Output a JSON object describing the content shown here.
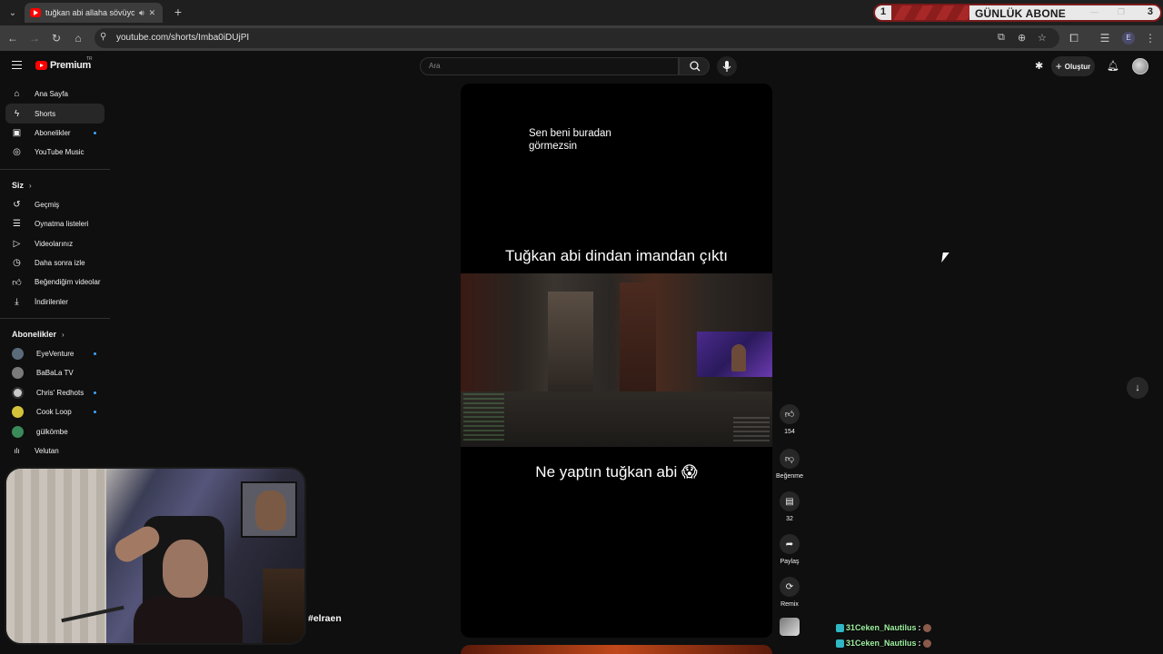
{
  "browser": {
    "tab_title": "tuğkan abi allaha sövüyor 4",
    "url": "youtube.com/shorts/Imba0iDUjPI",
    "profile_initial": "E"
  },
  "overlay_banner": {
    "left_number": "1",
    "label": "GÜNLÜK ABONE",
    "right_number": "3"
  },
  "header": {
    "logo_text": "Premium",
    "region": "TR",
    "search_placeholder": "Ara",
    "create_label": "Oluştur"
  },
  "sidebar": {
    "main": [
      {
        "label": "Ana Sayfa",
        "icon": "home-icon"
      },
      {
        "label": "Shorts",
        "icon": "shorts-icon"
      },
      {
        "label": "Abonelikler",
        "icon": "subscriptions-icon"
      },
      {
        "label": "YouTube Music",
        "icon": "music-icon"
      }
    ],
    "you_title": "Siz",
    "you": [
      {
        "label": "Geçmiş",
        "icon": "history-icon"
      },
      {
        "label": "Oynatma listeleri",
        "icon": "playlist-icon"
      },
      {
        "label": "Videolarınız",
        "icon": "your-videos-icon"
      },
      {
        "label": "Daha sonra izle",
        "icon": "watch-later-icon"
      },
      {
        "label": "Beğendiğim videolar",
        "icon": "liked-icon"
      },
      {
        "label": "İndirilenler",
        "icon": "download-icon"
      }
    ],
    "subs_title": "Abonelikler",
    "subs": [
      {
        "label": "EyeVenture",
        "color": "#5a6b7a"
      },
      {
        "label": "BaBaLa TV",
        "color": "#7a7a7a"
      },
      {
        "label": "Chris' Redhots",
        "color": "#c9c9c9"
      },
      {
        "label": "Cook Loop",
        "color": "#d4c23a"
      },
      {
        "label": "gülkömbe",
        "color": "#3a8a5a"
      },
      {
        "label": "Velutan",
        "color": "#555555"
      }
    ]
  },
  "short": {
    "caption_top_line1": "Sen beni buradan",
    "caption_top_line2": "görmezsin",
    "caption_middle": "Tuğkan abi dindan imandan çıktı",
    "caption_bottom": "Ne yaptın tuğkan abi 😱"
  },
  "actions": {
    "likes": "154",
    "dislike_label": "Beğenme",
    "comments": "32",
    "share_label": "Paylaş",
    "remix_label": "Remix"
  },
  "stream_overlay": {
    "hashtag": "#elraen",
    "chat": [
      {
        "user": "31Ceken_Nautilus"
      },
      {
        "user": "31Ceken_Nautilus"
      }
    ]
  },
  "colors": {
    "yt_red": "#ff0000",
    "accent_blue": "#3ea6ff",
    "chat_name": "#9ef0a0"
  }
}
